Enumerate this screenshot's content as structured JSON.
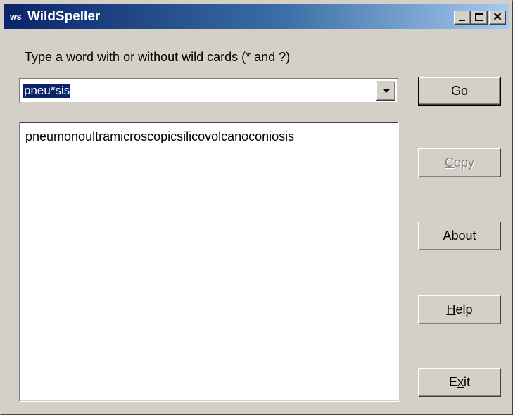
{
  "window": {
    "icon_text": "ws",
    "title": "WildSpeller"
  },
  "prompt": "Type a word with or without wild cards (* and ?)",
  "search": {
    "value": "pneu*sis"
  },
  "results": [
    "pneumonoultramicroscopicsilicovolcanoconiosis"
  ],
  "buttons": {
    "go": {
      "access": "G",
      "rest": "o"
    },
    "copy": {
      "access": "C",
      "rest": "opy"
    },
    "about": {
      "access": "A",
      "rest": "bout"
    },
    "help": {
      "access": "H",
      "rest": "elp"
    },
    "exit": {
      "pre": "E",
      "access": "x",
      "rest": "it"
    }
  },
  "colors": {
    "face": "#d4d0c8",
    "titlebar_start": "#0a246a",
    "titlebar_end": "#a6caf0",
    "selection": "#0a246a"
  },
  "icons": [
    "app-icon",
    "minimize-icon",
    "maximize-icon",
    "close-icon",
    "dropdown-arrow-icon"
  ]
}
